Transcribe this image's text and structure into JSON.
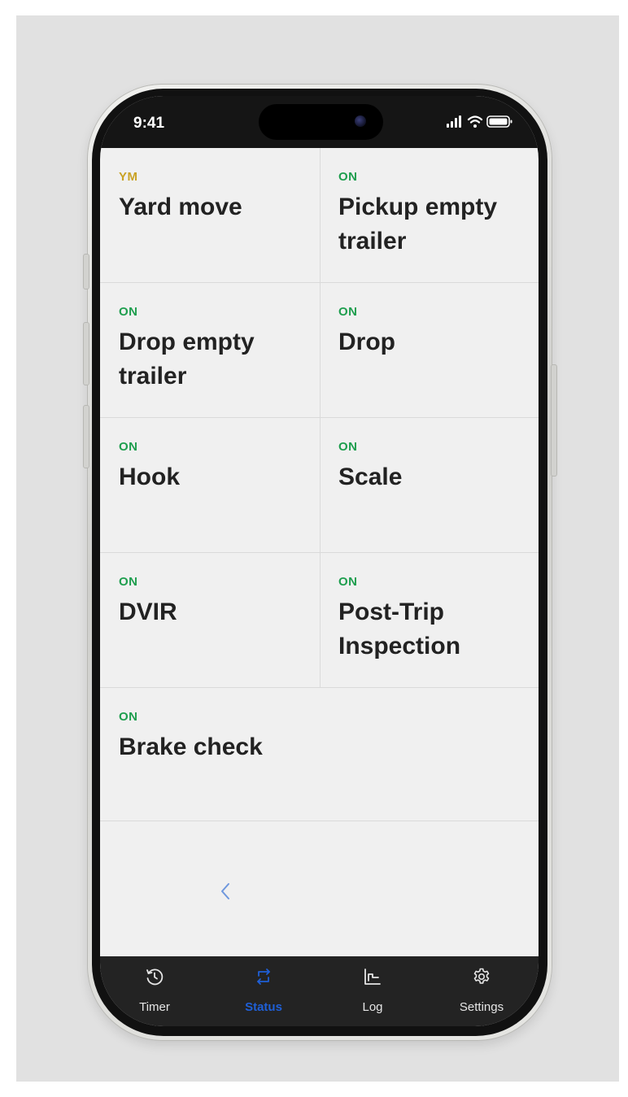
{
  "status_bar": {
    "time": "9:41"
  },
  "statuses": [
    {
      "badge": "YM",
      "label": "Yard move",
      "badge_color": "#c9a224"
    },
    {
      "badge": "ON",
      "label": "Pickup empty trailer",
      "badge_color": "#1e9e4e"
    },
    {
      "badge": "ON",
      "label": "Drop empty trailer",
      "badge_color": "#1e9e4e"
    },
    {
      "badge": "ON",
      "label": "Drop",
      "badge_color": "#1e9e4e"
    },
    {
      "badge": "ON",
      "label": "Hook",
      "badge_color": "#1e9e4e"
    },
    {
      "badge": "ON",
      "label": "Scale",
      "badge_color": "#1e9e4e"
    },
    {
      "badge": "ON",
      "label": "DVIR",
      "badge_color": "#1e9e4e"
    },
    {
      "badge": "ON",
      "label": "Post-Trip Inspection",
      "badge_color": "#1e9e4e"
    },
    {
      "badge": "ON",
      "label": "Brake check",
      "badge_color": "#1e9e4e"
    }
  ],
  "pager": {
    "prev_icon": "chevron-left-icon"
  },
  "tabs": [
    {
      "label": "Timer",
      "icon": "history-clock-icon",
      "active": false
    },
    {
      "label": "Status",
      "icon": "swap-arrows-icon",
      "active": true
    },
    {
      "label": "Log",
      "icon": "log-chart-icon",
      "active": false
    },
    {
      "label": "Settings",
      "icon": "gear-icon",
      "active": false
    }
  ],
  "colors": {
    "accent": "#1f5fd6",
    "on": "#1e9e4e",
    "yard_move": "#c9a224",
    "tab_bar": "#232323"
  }
}
